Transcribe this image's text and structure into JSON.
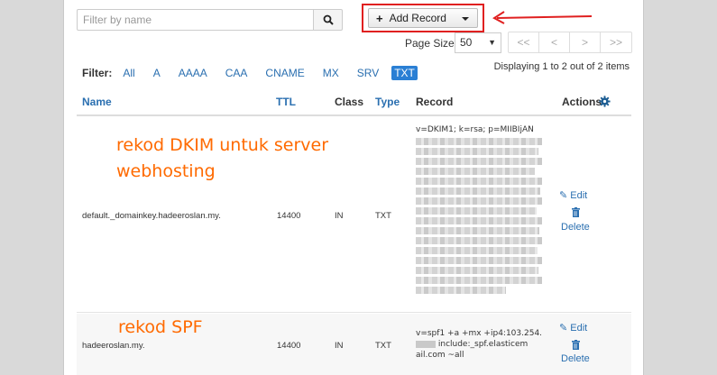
{
  "search": {
    "placeholder": "Filter by name"
  },
  "toolbar": {
    "add_label": "Add Record"
  },
  "paging": {
    "page_size_label": "Page Size",
    "page_size_value": "50",
    "buttons": [
      "<<",
      "<",
      ">",
      ">>"
    ],
    "displaying": "Displaying 1 to 2 out of 2 items"
  },
  "filter": {
    "label": "Filter:",
    "items": [
      "All",
      "A",
      "AAAA",
      "CAA",
      "CNAME",
      "MX",
      "SRV",
      "TXT"
    ],
    "active": "TXT"
  },
  "table": {
    "headers": {
      "name": "Name",
      "ttl": "TTL",
      "class": "Class",
      "type": "Type",
      "record": "Record",
      "actions": "Actions"
    },
    "rows": [
      {
        "name": "default._domainkey.hadeeroslan.my.",
        "ttl": "14400",
        "class": "IN",
        "type": "TXT",
        "record": "v=DKIM1; k=rsa; p=MIIBIjAN",
        "edit": "Edit",
        "delete": "Delete"
      },
      {
        "name": "hadeeroslan.my.",
        "ttl": "14400",
        "class": "IN",
        "type": "TXT",
        "record_line1": "v=spf1 +a +mx +ip4:103.254.",
        "record_line2": " include:_spf.elasticem",
        "record_line3": "ail.com ~all",
        "edit": "Edit",
        "delete": "Delete"
      }
    ]
  },
  "annotations": {
    "dkim_line1": "rekod DKIM  untuk server",
    "dkim_line2": "webhosting",
    "spf": "rekod SPF"
  },
  "colors": {
    "link": "#2a6fb0",
    "active_filter": "#2a7fd4",
    "highlight_box": "#e02020",
    "annotation": "#ff6a00"
  },
  "icons": [
    "search-icon",
    "plus-icon",
    "caret-down-icon",
    "red-arrow-icon",
    "gear-icon",
    "pencil-icon",
    "trash-icon"
  ]
}
